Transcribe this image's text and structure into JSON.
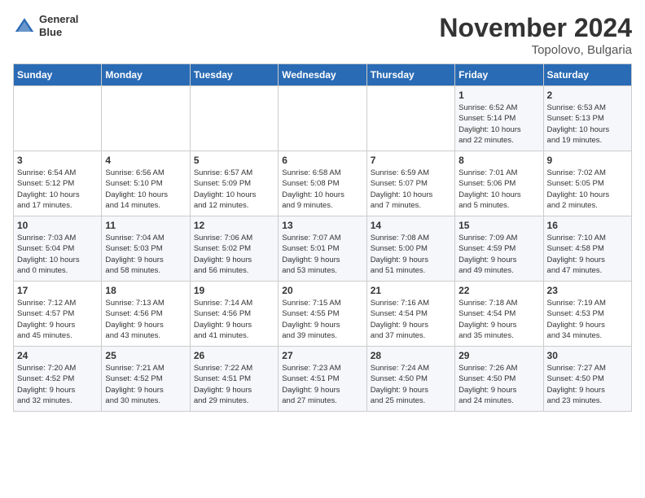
{
  "header": {
    "logo_line1": "General",
    "logo_line2": "Blue",
    "month_title": "November 2024",
    "location": "Topolovo, Bulgaria"
  },
  "weekdays": [
    "Sunday",
    "Monday",
    "Tuesday",
    "Wednesday",
    "Thursday",
    "Friday",
    "Saturday"
  ],
  "weeks": [
    [
      {
        "day": "",
        "info": ""
      },
      {
        "day": "",
        "info": ""
      },
      {
        "day": "",
        "info": ""
      },
      {
        "day": "",
        "info": ""
      },
      {
        "day": "",
        "info": ""
      },
      {
        "day": "1",
        "info": "Sunrise: 6:52 AM\nSunset: 5:14 PM\nDaylight: 10 hours\nand 22 minutes."
      },
      {
        "day": "2",
        "info": "Sunrise: 6:53 AM\nSunset: 5:13 PM\nDaylight: 10 hours\nand 19 minutes."
      }
    ],
    [
      {
        "day": "3",
        "info": "Sunrise: 6:54 AM\nSunset: 5:12 PM\nDaylight: 10 hours\nand 17 minutes."
      },
      {
        "day": "4",
        "info": "Sunrise: 6:56 AM\nSunset: 5:10 PM\nDaylight: 10 hours\nand 14 minutes."
      },
      {
        "day": "5",
        "info": "Sunrise: 6:57 AM\nSunset: 5:09 PM\nDaylight: 10 hours\nand 12 minutes."
      },
      {
        "day": "6",
        "info": "Sunrise: 6:58 AM\nSunset: 5:08 PM\nDaylight: 10 hours\nand 9 minutes."
      },
      {
        "day": "7",
        "info": "Sunrise: 6:59 AM\nSunset: 5:07 PM\nDaylight: 10 hours\nand 7 minutes."
      },
      {
        "day": "8",
        "info": "Sunrise: 7:01 AM\nSunset: 5:06 PM\nDaylight: 10 hours\nand 5 minutes."
      },
      {
        "day": "9",
        "info": "Sunrise: 7:02 AM\nSunset: 5:05 PM\nDaylight: 10 hours\nand 2 minutes."
      }
    ],
    [
      {
        "day": "10",
        "info": "Sunrise: 7:03 AM\nSunset: 5:04 PM\nDaylight: 10 hours\nand 0 minutes."
      },
      {
        "day": "11",
        "info": "Sunrise: 7:04 AM\nSunset: 5:03 PM\nDaylight: 9 hours\nand 58 minutes."
      },
      {
        "day": "12",
        "info": "Sunrise: 7:06 AM\nSunset: 5:02 PM\nDaylight: 9 hours\nand 56 minutes."
      },
      {
        "day": "13",
        "info": "Sunrise: 7:07 AM\nSunset: 5:01 PM\nDaylight: 9 hours\nand 53 minutes."
      },
      {
        "day": "14",
        "info": "Sunrise: 7:08 AM\nSunset: 5:00 PM\nDaylight: 9 hours\nand 51 minutes."
      },
      {
        "day": "15",
        "info": "Sunrise: 7:09 AM\nSunset: 4:59 PM\nDaylight: 9 hours\nand 49 minutes."
      },
      {
        "day": "16",
        "info": "Sunrise: 7:10 AM\nSunset: 4:58 PM\nDaylight: 9 hours\nand 47 minutes."
      }
    ],
    [
      {
        "day": "17",
        "info": "Sunrise: 7:12 AM\nSunset: 4:57 PM\nDaylight: 9 hours\nand 45 minutes."
      },
      {
        "day": "18",
        "info": "Sunrise: 7:13 AM\nSunset: 4:56 PM\nDaylight: 9 hours\nand 43 minutes."
      },
      {
        "day": "19",
        "info": "Sunrise: 7:14 AM\nSunset: 4:56 PM\nDaylight: 9 hours\nand 41 minutes."
      },
      {
        "day": "20",
        "info": "Sunrise: 7:15 AM\nSunset: 4:55 PM\nDaylight: 9 hours\nand 39 minutes."
      },
      {
        "day": "21",
        "info": "Sunrise: 7:16 AM\nSunset: 4:54 PM\nDaylight: 9 hours\nand 37 minutes."
      },
      {
        "day": "22",
        "info": "Sunrise: 7:18 AM\nSunset: 4:54 PM\nDaylight: 9 hours\nand 35 minutes."
      },
      {
        "day": "23",
        "info": "Sunrise: 7:19 AM\nSunset: 4:53 PM\nDaylight: 9 hours\nand 34 minutes."
      }
    ],
    [
      {
        "day": "24",
        "info": "Sunrise: 7:20 AM\nSunset: 4:52 PM\nDaylight: 9 hours\nand 32 minutes."
      },
      {
        "day": "25",
        "info": "Sunrise: 7:21 AM\nSunset: 4:52 PM\nDaylight: 9 hours\nand 30 minutes."
      },
      {
        "day": "26",
        "info": "Sunrise: 7:22 AM\nSunset: 4:51 PM\nDaylight: 9 hours\nand 29 minutes."
      },
      {
        "day": "27",
        "info": "Sunrise: 7:23 AM\nSunset: 4:51 PM\nDaylight: 9 hours\nand 27 minutes."
      },
      {
        "day": "28",
        "info": "Sunrise: 7:24 AM\nSunset: 4:50 PM\nDaylight: 9 hours\nand 25 minutes."
      },
      {
        "day": "29",
        "info": "Sunrise: 7:26 AM\nSunset: 4:50 PM\nDaylight: 9 hours\nand 24 minutes."
      },
      {
        "day": "30",
        "info": "Sunrise: 7:27 AM\nSunset: 4:50 PM\nDaylight: 9 hours\nand 23 minutes."
      }
    ]
  ]
}
